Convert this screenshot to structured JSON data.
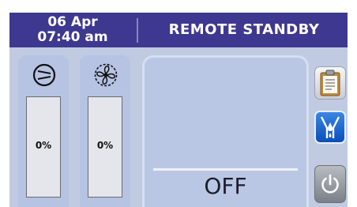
{
  "header": {
    "date": "06 Apr",
    "time": "07:40 am",
    "status": "REMOTE STANDBY"
  },
  "columns": [
    {
      "icon": "compressor-icon",
      "value": "0%"
    },
    {
      "icon": "fan-icon",
      "value": "0%"
    }
  ],
  "main": {
    "state": "OFF"
  },
  "side_buttons": [
    {
      "icon": "clipboard-icon"
    },
    {
      "icon": "fluid-valve-icon"
    },
    {
      "icon": "power-icon"
    }
  ],
  "colors": {
    "header_bg": "#3e3890",
    "panel_bg": "#c0cbe2",
    "accent_blue": "#1f63cc"
  }
}
